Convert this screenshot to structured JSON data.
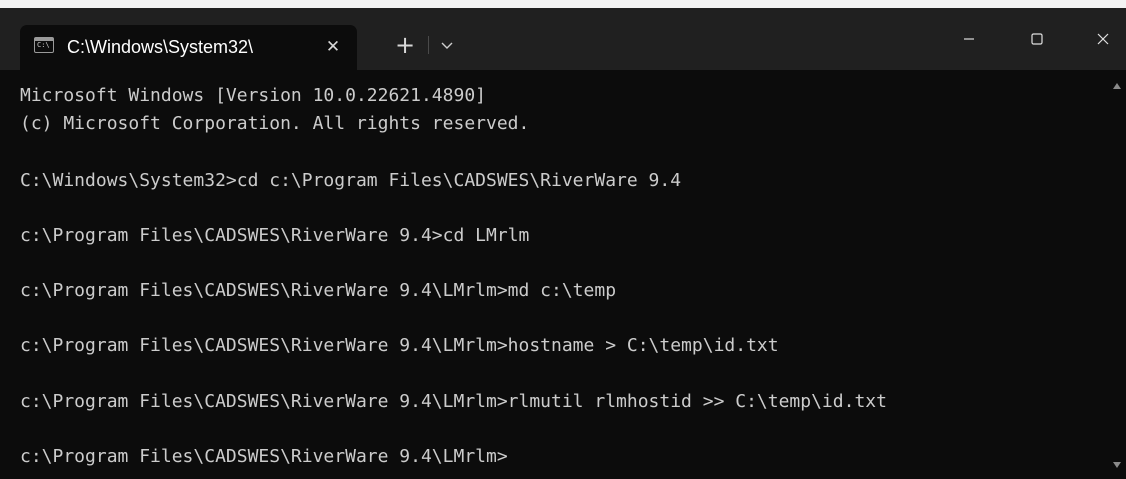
{
  "window": {
    "tab_title": "C:\\Windows\\System32\\",
    "tab_icon_text": "C:\\",
    "tab_close_glyph": "✕",
    "new_tab_glyph": "+",
    "icons": {
      "tab_icon": "cmd-icon",
      "tab_close": "close-icon",
      "new_tab": "plus-icon",
      "dropdown": "chevron-down-icon",
      "minimize": "minimize-icon",
      "maximize": "maximize-icon",
      "close": "close-icon"
    },
    "colors": {
      "titlebar": "#202020",
      "terminal_bg": "#0c0c0c",
      "terminal_fg": "#cccccc"
    }
  },
  "terminal": {
    "lines": [
      "Microsoft Windows [Version 10.0.22621.4890]",
      "(c) Microsoft Corporation. All rights reserved.",
      "C:\\Windows\\System32>cd c:\\Program Files\\CADSWES\\RiverWare 9.4",
      "c:\\Program Files\\CADSWES\\RiverWare 9.4>cd LMrlm",
      "c:\\Program Files\\CADSWES\\RiverWare 9.4\\LMrlm>md c:\\temp",
      "c:\\Program Files\\CADSWES\\RiverWare 9.4\\LMrlm>hostname > C:\\temp\\id.txt",
      "c:\\Program Files\\CADSWES\\RiverWare 9.4\\LMrlm>rlmutil rlmhostid >> C:\\temp\\id.txt",
      "c:\\Program Files\\CADSWES\\RiverWare 9.4\\LMrlm>"
    ]
  }
}
